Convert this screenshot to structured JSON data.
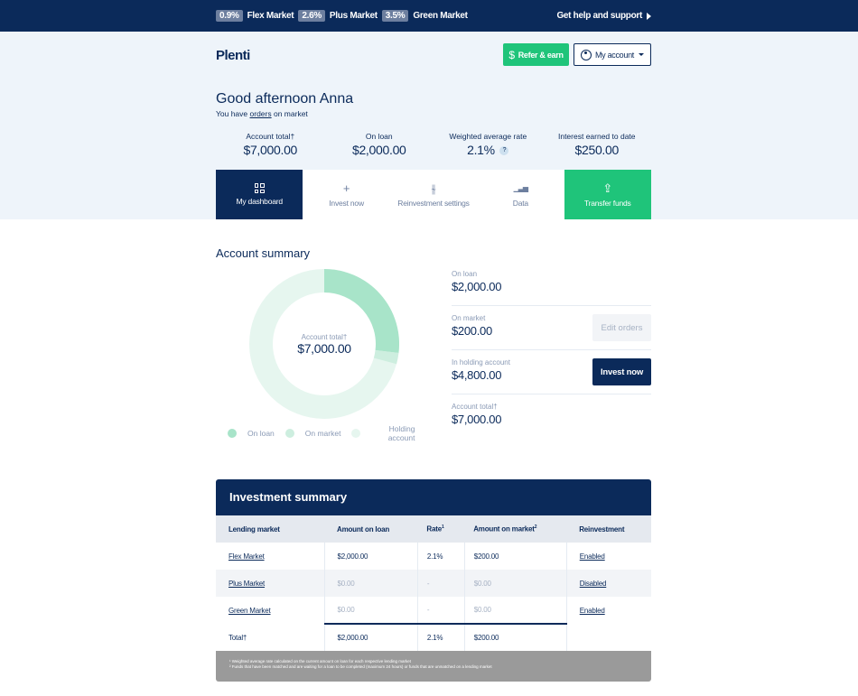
{
  "topbar": {
    "rates": [
      {
        "value": "0.9%",
        "label": "Flex Market"
      },
      {
        "value": "2.6%",
        "label": "Plus Market"
      },
      {
        "value": "3.5%",
        "label": "Green Market"
      }
    ],
    "help": "Get help and support"
  },
  "header": {
    "logo": "Plenti",
    "refer_label": "Refer & earn",
    "account_label": "My account"
  },
  "greeting": {
    "title": "Good afternoon Anna",
    "sub_prefix": "You have",
    "sub_link": "orders",
    "sub_suffix": "on market"
  },
  "stats": [
    {
      "label": "Account total†",
      "value": "$7,000.00"
    },
    {
      "label": "On loan",
      "value": "$2,000.00"
    },
    {
      "label": "Weighted average rate",
      "value": "2.1%",
      "help": "?"
    },
    {
      "label": "Interest earned to date",
      "value": "$250.00"
    }
  ],
  "tabs": [
    {
      "label": "My dashboard",
      "icon": "grid-icon"
    },
    {
      "label": "Invest now",
      "icon": "plus-icon",
      "glyph": "+"
    },
    {
      "label": "Reinvestment settings",
      "icon": "sliders-icon",
      "glyph": "⫳"
    },
    {
      "label": "Data",
      "icon": "bar-chart-icon",
      "glyph": "▁▃▅"
    },
    {
      "label": "Transfer funds",
      "icon": "transfer-icon",
      "glyph": "⇪"
    }
  ],
  "account_summary": {
    "title": "Account summary",
    "donut_label": "Account total†",
    "donut_value": "$7,000.00",
    "legend": [
      "On loan",
      "On market",
      "Holding account"
    ],
    "colors": {
      "on_loan": "#a8e4c9",
      "on_market": "#cdeedf",
      "holding": "#e6f6ef"
    },
    "rows": [
      {
        "label": "On loan",
        "value": "$2,000.00"
      },
      {
        "label": "On market",
        "value": "$200.00"
      },
      {
        "label": "In holding account",
        "value": "$4,800.00"
      },
      {
        "label": "Account total†",
        "value": "$7,000.00"
      }
    ],
    "edit_label": "Edit orders",
    "invest_label": "Invest now"
  },
  "investment_summary": {
    "title": "Investment summary",
    "headers": [
      "Lending market",
      "Amount on loan",
      "Rate",
      "Amount on market",
      "Reinvestment"
    ],
    "header_sups": [
      "",
      "",
      "1",
      "2",
      ""
    ],
    "rows": [
      {
        "market": "Flex Market",
        "loan": "$2,000.00",
        "rate": "2.1%",
        "on_market": "$200.00",
        "reinvestment": "Enabled"
      },
      {
        "market": "Plus Market",
        "loan": "$0.00",
        "rate": "-",
        "on_market": "$0.00",
        "reinvestment": "Disabled"
      },
      {
        "market": "Green Market",
        "loan": "$0.00",
        "rate": "-",
        "on_market": "$0.00",
        "reinvestment": "Enabled"
      }
    ],
    "total": {
      "label": "Total†",
      "loan": "$2,000.00",
      "rate": "2.1%",
      "on_market": "$200.00"
    },
    "footnotes": [
      "¹ Weighted average rate calculated on the current amount on loan for each respective lending market",
      "² Funds that have been matched and are waiting for a loan to be completed (maximum 24 hours) or funds that are unmatched on a lending market"
    ]
  }
}
